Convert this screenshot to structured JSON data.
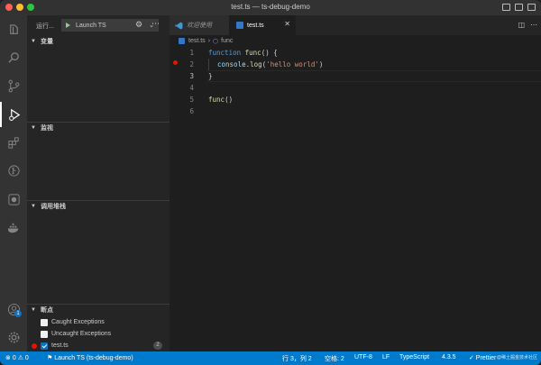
{
  "window": {
    "title": "test.ts — ts-debug-demo"
  },
  "sidebar": {
    "run_label": "运行...",
    "launch_config": "Launch TS",
    "sections": {
      "variables": "变量",
      "watch": "监视",
      "call_stack": "调用堆栈",
      "breakpoints": "断点"
    },
    "breakpoints": [
      {
        "label": "Caught Exceptions",
        "checked": false
      },
      {
        "label": "Uncaught Exceptions",
        "checked": false
      },
      {
        "label": "test.ts",
        "checked": true,
        "count": "2"
      }
    ]
  },
  "activity_bar": {
    "items": [
      "files-icon",
      "search-icon",
      "source-control-icon",
      "run-debug-icon",
      "extensions-icon",
      "git-graph-icon",
      "github-icon",
      "docker-icon"
    ],
    "account_badge": "1"
  },
  "editor": {
    "tabs": [
      {
        "label": "欢迎使用",
        "active": false
      },
      {
        "label": "test.ts",
        "active": true
      }
    ],
    "breadcrumb": {
      "file": "test.ts",
      "symbol": "func"
    },
    "lines": [
      {
        "n": "1"
      },
      {
        "n": "2"
      },
      {
        "n": "3"
      },
      {
        "n": "4"
      },
      {
        "n": "5"
      },
      {
        "n": "6"
      }
    ],
    "code": {
      "l1_kw": "function",
      "l1_fn": "func",
      "l1_rest": "() {",
      "l2_obj": "console",
      "l2_dot": ".",
      "l2_fn": "log",
      "l2_open": "(",
      "l2_str": "'hello world'",
      "l2_close": ")",
      "l3": "}",
      "l5_fn": "func",
      "l5_rest": "()"
    }
  },
  "status_bar": {
    "problems": "0",
    "warnings": "0",
    "debug_target": "Launch TS (ts-debug-demo)",
    "position": "行 3，列 2",
    "spaces": "空格: 2",
    "encoding": "UTF-8",
    "eol": "LF",
    "language": "TypeScript",
    "ts_version": "4.3.5",
    "prettier": "✓ Prettier",
    "watermark": "@稀土掘金技术社区"
  },
  "colors": {
    "accent": "#007acc",
    "breakpoint": "#e51400",
    "activity_bar": "#333333",
    "sidebar": "#252526",
    "editor": "#1e1e1e"
  }
}
